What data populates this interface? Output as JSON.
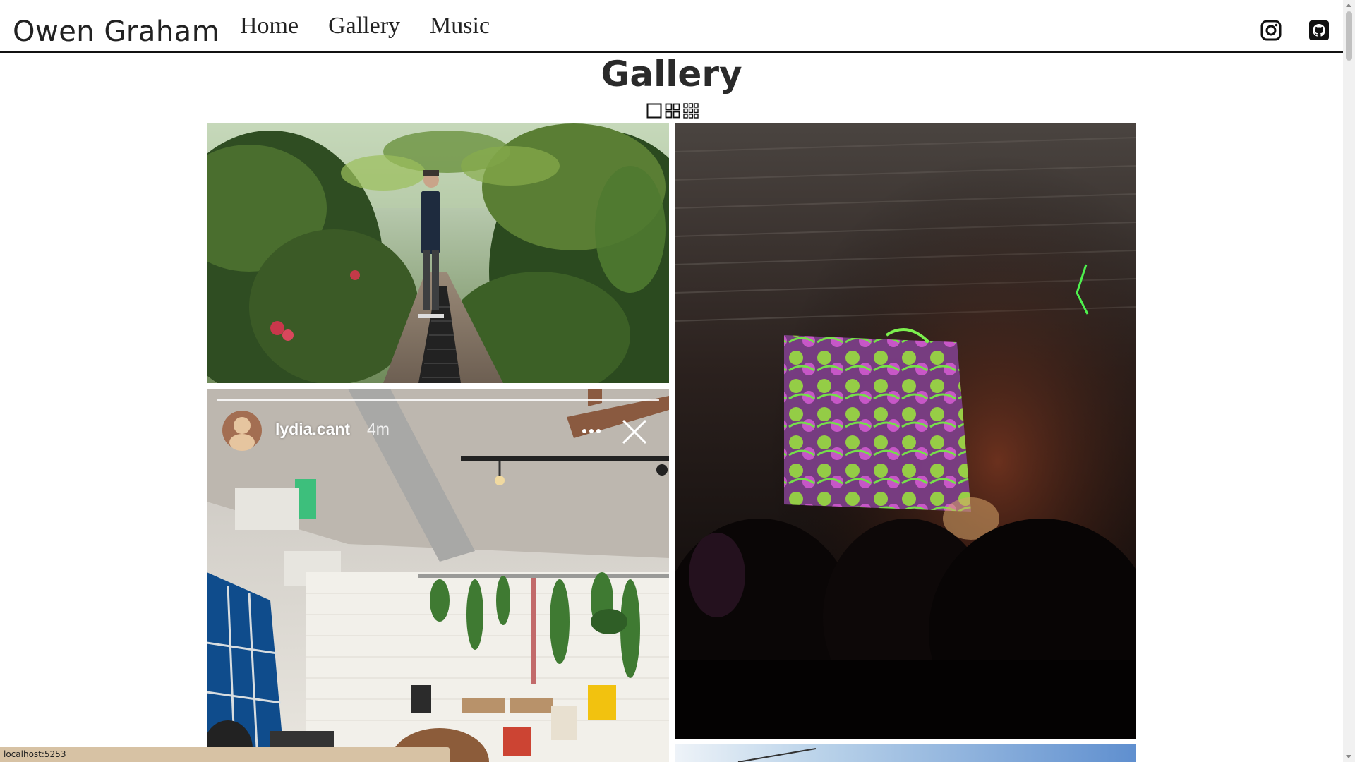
{
  "header": {
    "brand": "Owen Graham",
    "nav": [
      {
        "label": "Home"
      },
      {
        "label": "Gallery"
      },
      {
        "label": "Music"
      }
    ],
    "social": [
      {
        "icon": "instagram-icon"
      },
      {
        "icon": "github-icon"
      }
    ]
  },
  "main": {
    "title": "Gallery",
    "layout_options": [
      "single-column-icon",
      "two-column-grid-icon",
      "three-column-grid-icon"
    ]
  },
  "photos": [
    {
      "subject": "greenhouse"
    },
    {
      "subject": "concert"
    },
    {
      "subject": "story",
      "story_user": "lydia.cant",
      "story_time": "4m"
    },
    {
      "subject": "sky"
    }
  ],
  "status_bar": {
    "url": "localhost:5253"
  },
  "colors": {
    "text": "#222222",
    "status_bar": "#d7c2a4",
    "rule": "#111111"
  }
}
